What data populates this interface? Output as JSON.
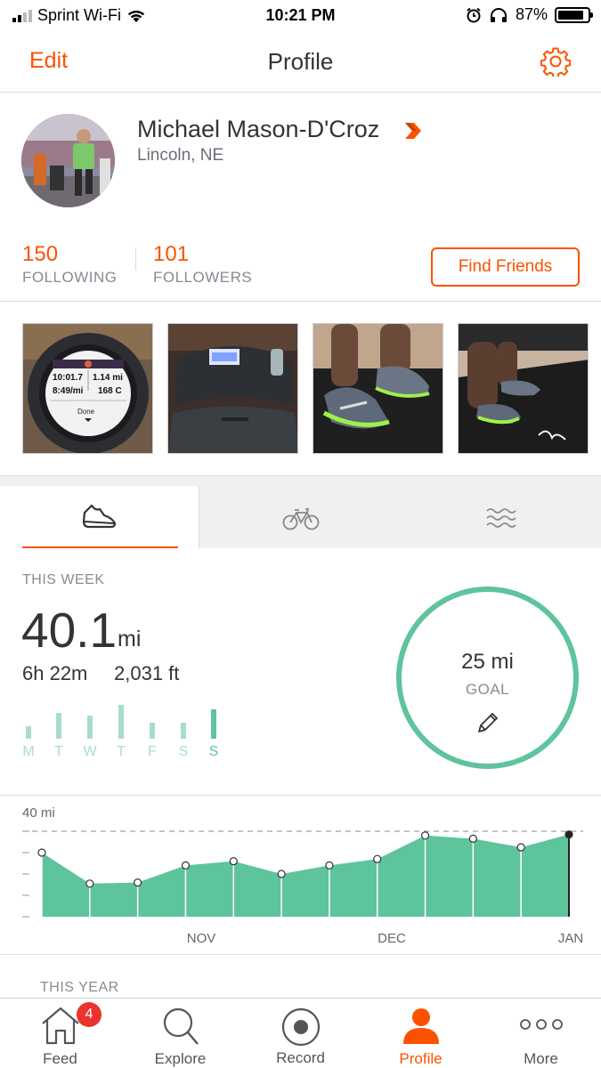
{
  "status_bar": {
    "carrier": "Sprint Wi-Fi",
    "time": "10:21 PM",
    "battery": "87%",
    "battery_level": 0.87
  },
  "nav": {
    "edit_label": "Edit",
    "title": "Profile",
    "settings_icon": "gear-icon"
  },
  "profile": {
    "name": "Michael Mason-D'Croz",
    "location": "Lincoln, NE",
    "following_count": "150",
    "following_label": "FOLLOWING",
    "followers_count": "101",
    "followers_label": "FOLLOWERS",
    "find_friends_label": "Find Friends"
  },
  "photos": {
    "watch_screen": {
      "time": "10:01.7",
      "distance": "1.14 mi",
      "pace": "8:49/mi",
      "temperature": "168 C",
      "button": "Done"
    }
  },
  "sport_tabs": [
    "run-shoe-icon",
    "bike-icon",
    "swim-waves-icon"
  ],
  "this_week": {
    "label": "THIS WEEK",
    "distance": "40.1",
    "unit": "mi",
    "time": "6h 22m",
    "elevation": "2,031 ft",
    "days": [
      "M",
      "T",
      "W",
      "T",
      "F",
      "S",
      "S"
    ],
    "daily_relative": [
      0.35,
      0.72,
      0.65,
      0.95,
      0.45,
      0.45,
      0.82
    ]
  },
  "goal": {
    "value": "25 mi",
    "label": "GOAL"
  },
  "chart_data": {
    "type": "area",
    "ylabel_top": "40 mi",
    "ylim": [
      0,
      40
    ],
    "x_labels": [
      "NOV",
      "DEC",
      "JAN"
    ],
    "values": [
      30,
      15.5,
      16,
      24,
      26,
      20,
      24,
      27,
      38,
      36.5,
      32.5,
      38.5
    ],
    "reference_line": 40,
    "color": "#5ec49b"
  },
  "this_year": {
    "label": "THIS YEAR"
  },
  "tab_bar": {
    "items": [
      {
        "label": "Feed",
        "icon": "home-icon",
        "badge": "4"
      },
      {
        "label": "Explore",
        "icon": "search-icon"
      },
      {
        "label": "Record",
        "icon": "record-icon"
      },
      {
        "label": "Profile",
        "icon": "person-icon",
        "active": true
      },
      {
        "label": "More",
        "icon": "more-dots-icon"
      }
    ]
  },
  "colors": {
    "accent": "#fc5200",
    "green": "#5ec49b",
    "badge": "#e8342c"
  }
}
